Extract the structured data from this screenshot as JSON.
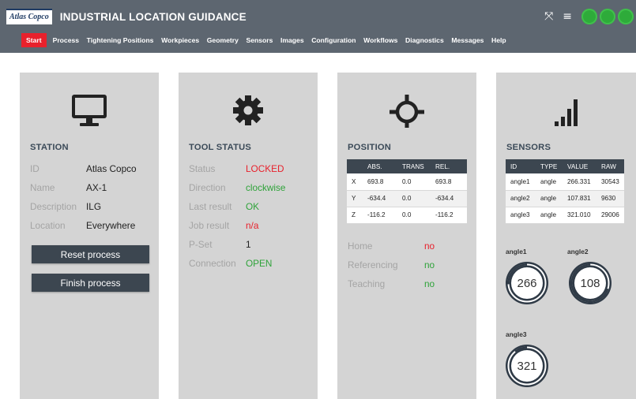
{
  "header": {
    "logo": "Atlas Copco",
    "title": "INDUSTRIAL LOCATION GUIDANCE",
    "fullscreen_icon": "expand-icon",
    "menu_icon": "hamburger-icon",
    "status_color": "#2eab3a"
  },
  "menu": [
    "Start",
    "Process",
    "Tightening Positions",
    "Workpieces",
    "Geometry",
    "Sensors",
    "Images",
    "Configuration",
    "Workflows",
    "Diagnostics",
    "Messages",
    "Help"
  ],
  "station": {
    "title": "STATION",
    "icon": "monitor-icon",
    "fields": [
      {
        "label": "ID",
        "value": "Atlas Copco"
      },
      {
        "label": "Name",
        "value": "AX-1"
      },
      {
        "label": "Description",
        "value": "ILG"
      },
      {
        "label": "Location",
        "value": "Everywhere"
      }
    ],
    "reset_label": "Reset process",
    "finish_label": "Finish process"
  },
  "tool": {
    "title": "TOOL STATUS",
    "icon": "gear-icon",
    "fields": [
      {
        "label": "Status",
        "value": "LOCKED",
        "color": "#e8212c"
      },
      {
        "label": "Direction",
        "value": "clockwise",
        "color": "#2fa33a"
      },
      {
        "label": "Last result",
        "value": "OK",
        "color": "#2fa33a"
      },
      {
        "label": "Job result",
        "value": "n/a",
        "color": "#e8212c"
      },
      {
        "label": "P-Set",
        "value": "1",
        "color": "#222222"
      },
      {
        "label": "Connection",
        "value": "OPEN",
        "color": "#2fa33a"
      }
    ]
  },
  "position": {
    "title": "POSITION",
    "icon": "crosshair-icon",
    "columns": [
      "",
      "ABS.",
      "TRANS",
      "REL."
    ],
    "rows": [
      [
        "X",
        "693.8",
        "0.0",
        "693.8"
      ],
      [
        "Y",
        "-634.4",
        "0.0",
        "-634.4"
      ],
      [
        "Z",
        "-116.2",
        "0.0",
        "-116.2"
      ]
    ],
    "flags": [
      {
        "label": "Home",
        "value": "no",
        "color": "#e8212c"
      },
      {
        "label": "Referencing",
        "value": "no",
        "color": "#2fa33a"
      },
      {
        "label": "Teaching",
        "value": "no",
        "color": "#2fa33a"
      }
    ]
  },
  "sensors": {
    "title": "SENSORS",
    "icon": "signal-bars-icon",
    "columns": [
      "ID",
      "TYPE",
      "VALUE",
      "RAW"
    ],
    "rows": [
      [
        "angle1",
        "angle",
        "266.331",
        "30543"
      ],
      [
        "angle2",
        "angle",
        "107.831",
        "9630"
      ],
      [
        "angle3",
        "angle",
        "321.010",
        "29006"
      ]
    ],
    "gauges": [
      {
        "label": "angle1",
        "value": "266",
        "fraction": 0.74
      },
      {
        "label": "angle2",
        "value": "108",
        "fraction": 0.3
      },
      {
        "label": "angle3",
        "value": "321",
        "fraction": 0.89
      }
    ]
  }
}
